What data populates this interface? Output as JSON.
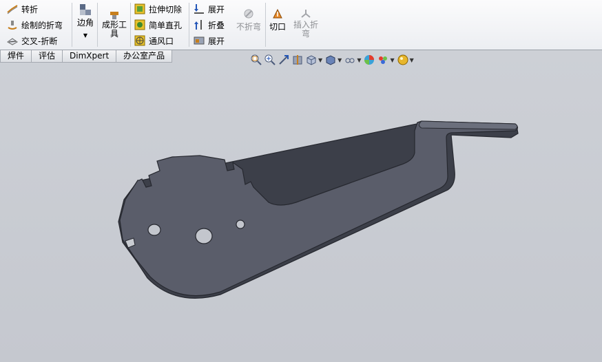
{
  "ribbon": {
    "col1": [
      "转折",
      "绘制的折弯",
      "交叉-折断"
    ],
    "corner_label": "边角",
    "forming_tool_label": "成形工具",
    "col3": [
      "拉伸切除",
      "简单直孔",
      "通风口"
    ],
    "col4": [
      "展开",
      "折叠",
      "展开"
    ],
    "no_bend_label": "不折弯",
    "cut_label": "切口",
    "insert_bend_label": "插入折弯"
  },
  "tabs": [
    "焊件",
    "评估",
    "DimXpert",
    "办公室产品"
  ],
  "view_toolbar": [
    "zoom-to-fit",
    "zoom-to-area",
    "previous-view",
    "section-view",
    "view-orientation",
    "display-style",
    "hide-show",
    "edit-appearance",
    "apply-scene",
    "view-setting"
  ],
  "colors": {
    "part": "#5a5d6a",
    "part_edge": "#26282f",
    "part_top": "#6b6f7c"
  }
}
